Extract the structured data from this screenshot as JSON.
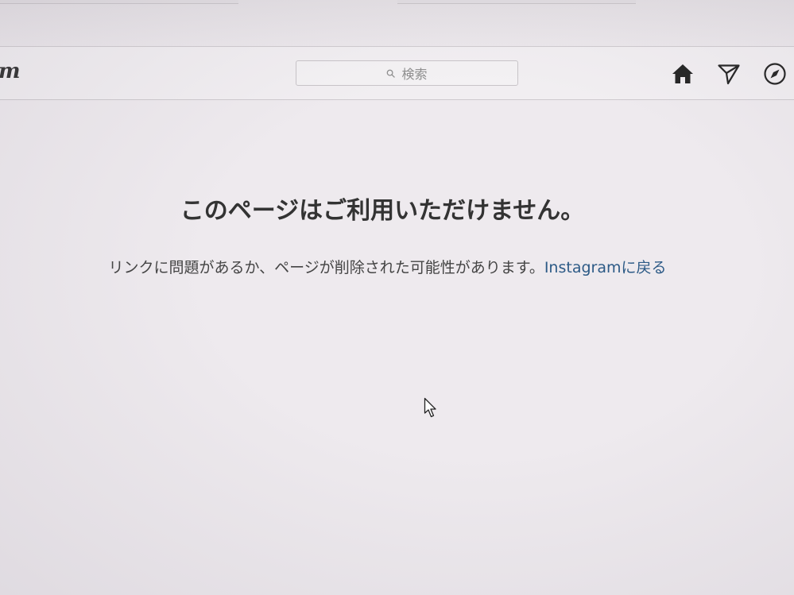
{
  "header": {
    "logo_text": "m",
    "search": {
      "placeholder": "検索",
      "icon": "search-icon"
    },
    "icons": [
      "home-icon",
      "direct-send-icon",
      "compass-icon"
    ]
  },
  "main": {
    "title": "このページはご利用いただけません。",
    "message": "リンクに問題があるか、ページが削除された可能性があります。",
    "back_link": "Instagramに戻る"
  },
  "colors": {
    "link": "#2c5a86",
    "text": "#262626",
    "background": "#eeeaee"
  }
}
